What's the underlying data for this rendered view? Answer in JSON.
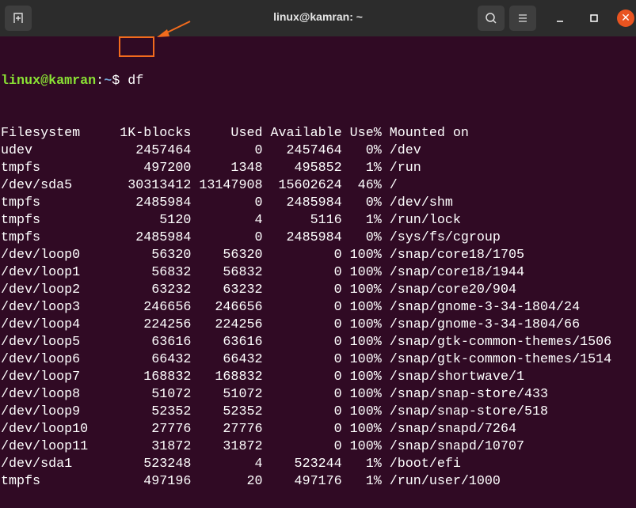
{
  "window": {
    "title": "linux@kamran: ~"
  },
  "prompt": {
    "user_host": "linux@kamran",
    "sep": ":",
    "path": "~",
    "symbol": "$",
    "command": "df"
  },
  "table": {
    "headers": [
      "Filesystem",
      "1K-blocks",
      "Used",
      "Available",
      "Use%",
      "Mounted on"
    ],
    "rows": [
      [
        "udev",
        "2457464",
        "0",
        "2457464",
        "0%",
        "/dev"
      ],
      [
        "tmpfs",
        "497200",
        "1348",
        "495852",
        "1%",
        "/run"
      ],
      [
        "/dev/sda5",
        "30313412",
        "13147908",
        "15602624",
        "46%",
        "/"
      ],
      [
        "tmpfs",
        "2485984",
        "0",
        "2485984",
        "0%",
        "/dev/shm"
      ],
      [
        "tmpfs",
        "5120",
        "4",
        "5116",
        "1%",
        "/run/lock"
      ],
      [
        "tmpfs",
        "2485984",
        "0",
        "2485984",
        "0%",
        "/sys/fs/cgroup"
      ],
      [
        "/dev/loop0",
        "56320",
        "56320",
        "0",
        "100%",
        "/snap/core18/1705"
      ],
      [
        "/dev/loop1",
        "56832",
        "56832",
        "0",
        "100%",
        "/snap/core18/1944"
      ],
      [
        "/dev/loop2",
        "63232",
        "63232",
        "0",
        "100%",
        "/snap/core20/904"
      ],
      [
        "/dev/loop3",
        "246656",
        "246656",
        "0",
        "100%",
        "/snap/gnome-3-34-1804/24"
      ],
      [
        "/dev/loop4",
        "224256",
        "224256",
        "0",
        "100%",
        "/snap/gnome-3-34-1804/66"
      ],
      [
        "/dev/loop5",
        "63616",
        "63616",
        "0",
        "100%",
        "/snap/gtk-common-themes/1506"
      ],
      [
        "/dev/loop6",
        "66432",
        "66432",
        "0",
        "100%",
        "/snap/gtk-common-themes/1514"
      ],
      [
        "/dev/loop7",
        "168832",
        "168832",
        "0",
        "100%",
        "/snap/shortwave/1"
      ],
      [
        "/dev/loop8",
        "51072",
        "51072",
        "0",
        "100%",
        "/snap/snap-store/433"
      ],
      [
        "/dev/loop9",
        "52352",
        "52352",
        "0",
        "100%",
        "/snap/snap-store/518"
      ],
      [
        "/dev/loop10",
        "27776",
        "27776",
        "0",
        "100%",
        "/snap/snapd/7264"
      ],
      [
        "/dev/loop11",
        "31872",
        "31872",
        "0",
        "100%",
        "/snap/snapd/10707"
      ],
      [
        "/dev/sda1",
        "523248",
        "4",
        "523244",
        "1%",
        "/boot/efi"
      ],
      [
        "tmpfs",
        "497196",
        "20",
        "497176",
        "1%",
        "/run/user/1000"
      ]
    ]
  },
  "colors": {
    "background": "#300a24",
    "titlebar": "#2c2c2c",
    "highlight": "#f26b1d",
    "close": "#e95420"
  }
}
